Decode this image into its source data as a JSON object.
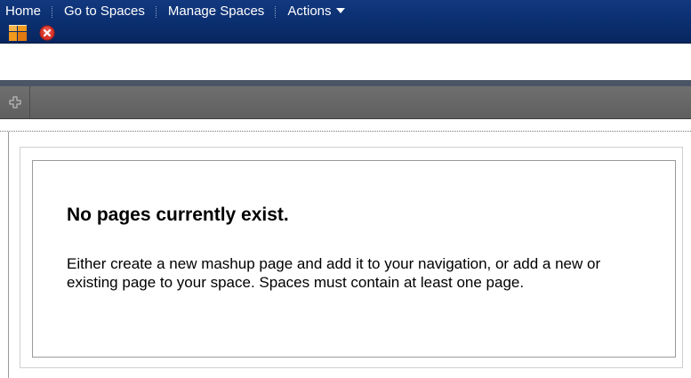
{
  "topnav": {
    "items": [
      {
        "label": "Home"
      },
      {
        "label": "Go to Spaces"
      },
      {
        "label": "Manage Spaces"
      },
      {
        "label": "Actions"
      }
    ],
    "icons": {
      "app": "spaces-app-icon",
      "close": "close-icon"
    }
  },
  "toolbar": {
    "add_icon": "add-page-icon"
  },
  "content": {
    "heading": "No pages currently exist.",
    "message": "Either create a new mashup page and add it to your navigation, or add a new or existing page to your space. Spaces must contain at least one page."
  },
  "colors": {
    "nav_background": "#0b2f70",
    "toolbar_background": "#666666",
    "close_red": "#d9342b",
    "app_icon_orange": "#f29a1d"
  }
}
